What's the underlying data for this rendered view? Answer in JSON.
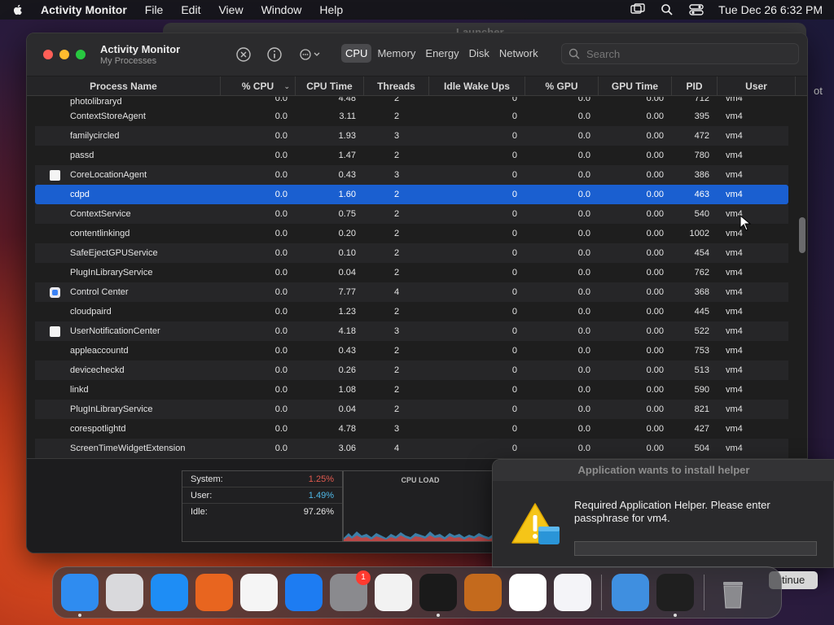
{
  "menubar": {
    "app_name": "Activity Monitor",
    "menus": [
      "File",
      "Edit",
      "View",
      "Window",
      "Help"
    ],
    "clock": "Tue Dec 26  6:32 PM"
  },
  "background": {
    "window_title": "Launcher",
    "side_text": "ot"
  },
  "window": {
    "title": "Activity Monitor",
    "subtitle": "My Processes",
    "tabs": [
      "CPU",
      "Memory",
      "Energy",
      "Disk",
      "Network"
    ],
    "active_tab": "CPU",
    "search_placeholder": "Search"
  },
  "table": {
    "columns": [
      "Process Name",
      "% CPU",
      "CPU Time",
      "Threads",
      "Idle Wake Ups",
      "% GPU",
      "GPU Time",
      "PID",
      "User"
    ],
    "partial_top": {
      "name": "photolibraryd",
      "cpu": "0.0",
      "cpu_time": "4.48",
      "threads": "2",
      "idle": "0",
      "gpu": "0.0",
      "gpu_time": "0.00",
      "pid": "712",
      "user": "vm4"
    },
    "rows": [
      {
        "name": "ContextStoreAgent",
        "icon": "none",
        "cpu": "0.0",
        "cpu_time": "3.11",
        "threads": "2",
        "idle": "0",
        "gpu": "0.0",
        "gpu_time": "0.00",
        "pid": "395",
        "user": "vm4"
      },
      {
        "name": "familycircled",
        "icon": "none",
        "cpu": "0.0",
        "cpu_time": "1.93",
        "threads": "3",
        "idle": "0",
        "gpu": "0.0",
        "gpu_time": "0.00",
        "pid": "472",
        "user": "vm4"
      },
      {
        "name": "passd",
        "icon": "none",
        "cpu": "0.0",
        "cpu_time": "1.47",
        "threads": "2",
        "idle": "0",
        "gpu": "0.0",
        "gpu_time": "0.00",
        "pid": "780",
        "user": "vm4"
      },
      {
        "name": "CoreLocationAgent",
        "icon": "white",
        "cpu": "0.0",
        "cpu_time": "0.43",
        "threads": "3",
        "idle": "0",
        "gpu": "0.0",
        "gpu_time": "0.00",
        "pid": "386",
        "user": "vm4"
      },
      {
        "name": "cdpd",
        "icon": "none",
        "cpu": "0.0",
        "cpu_time": "1.60",
        "threads": "2",
        "idle": "0",
        "gpu": "0.0",
        "gpu_time": "0.00",
        "pid": "463",
        "user": "vm4",
        "selected": true
      },
      {
        "name": "ContextService",
        "icon": "none",
        "cpu": "0.0",
        "cpu_time": "0.75",
        "threads": "2",
        "idle": "0",
        "gpu": "0.0",
        "gpu_time": "0.00",
        "pid": "540",
        "user": "vm4"
      },
      {
        "name": "contentlinkingd",
        "icon": "none",
        "cpu": "0.0",
        "cpu_time": "0.20",
        "threads": "2",
        "idle": "0",
        "gpu": "0.0",
        "gpu_time": "0.00",
        "pid": "1002",
        "user": "vm4"
      },
      {
        "name": "SafeEjectGPUService",
        "icon": "none",
        "cpu": "0.0",
        "cpu_time": "0.10",
        "threads": "2",
        "idle": "0",
        "gpu": "0.0",
        "gpu_time": "0.00",
        "pid": "454",
        "user": "vm4"
      },
      {
        "name": "PlugInLibraryService",
        "icon": "none",
        "cpu": "0.0",
        "cpu_time": "0.04",
        "threads": "2",
        "idle": "0",
        "gpu": "0.0",
        "gpu_time": "0.00",
        "pid": "762",
        "user": "vm4"
      },
      {
        "name": "Control Center",
        "icon": "cc",
        "cpu": "0.0",
        "cpu_time": "7.77",
        "threads": "4",
        "idle": "0",
        "gpu": "0.0",
        "gpu_time": "0.00",
        "pid": "368",
        "user": "vm4"
      },
      {
        "name": "cloudpaird",
        "icon": "none",
        "cpu": "0.0",
        "cpu_time": "1.23",
        "threads": "2",
        "idle": "0",
        "gpu": "0.0",
        "gpu_time": "0.00",
        "pid": "445",
        "user": "vm4"
      },
      {
        "name": "UserNotificationCenter",
        "icon": "white",
        "cpu": "0.0",
        "cpu_time": "4.18",
        "threads": "3",
        "idle": "0",
        "gpu": "0.0",
        "gpu_time": "0.00",
        "pid": "522",
        "user": "vm4"
      },
      {
        "name": "appleaccountd",
        "icon": "none",
        "cpu": "0.0",
        "cpu_time": "0.43",
        "threads": "2",
        "idle": "0",
        "gpu": "0.0",
        "gpu_time": "0.00",
        "pid": "753",
        "user": "vm4"
      },
      {
        "name": "devicecheckd",
        "icon": "none",
        "cpu": "0.0",
        "cpu_time": "0.26",
        "threads": "2",
        "idle": "0",
        "gpu": "0.0",
        "gpu_time": "0.00",
        "pid": "513",
        "user": "vm4"
      },
      {
        "name": "linkd",
        "icon": "none",
        "cpu": "0.0",
        "cpu_time": "1.08",
        "threads": "2",
        "idle": "0",
        "gpu": "0.0",
        "gpu_time": "0.00",
        "pid": "590",
        "user": "vm4"
      },
      {
        "name": "PlugInLibraryService",
        "icon": "none",
        "cpu": "0.0",
        "cpu_time": "0.04",
        "threads": "2",
        "idle": "0",
        "gpu": "0.0",
        "gpu_time": "0.00",
        "pid": "821",
        "user": "vm4"
      },
      {
        "name": "corespotlightd",
        "icon": "none",
        "cpu": "0.0",
        "cpu_time": "4.78",
        "threads": "3",
        "idle": "0",
        "gpu": "0.0",
        "gpu_time": "0.00",
        "pid": "427",
        "user": "vm4"
      },
      {
        "name": "ScreenTimeWidgetExtension",
        "icon": "none",
        "cpu": "0.0",
        "cpu_time": "3.06",
        "threads": "4",
        "idle": "0",
        "gpu": "0.0",
        "gpu_time": "0.00",
        "pid": "504",
        "user": "vm4"
      }
    ]
  },
  "stats": {
    "system_label": "System:",
    "system_value": "1.25%",
    "system_color": "#e25a4f",
    "user_label": "User:",
    "user_value": "1.49%",
    "user_color": "#4fb8e8",
    "idle_label": "Idle:",
    "idle_value": "97.26%"
  },
  "cpu_load": {
    "label": "CPU LOAD"
  },
  "dialog": {
    "title": "Application wants to install helper",
    "message": "Required Application Helper. Please enter passphrase for vm4.",
    "continue_label": "tinue"
  },
  "dock": {
    "items": [
      {
        "name": "finder",
        "color": "#2f8cf0"
      },
      {
        "name": "launchpad",
        "color": "#d9d9dc"
      },
      {
        "name": "safari",
        "color": "#1e8df5"
      },
      {
        "name": "firefox",
        "color": "#e8651f"
      },
      {
        "name": "chrome",
        "color": "#f5f5f5"
      },
      {
        "name": "app-store",
        "color": "#1d7cf2"
      },
      {
        "name": "system-settings",
        "color": "#8a8a8e",
        "badge": "1"
      },
      {
        "name": "textedit",
        "color": "#f2f2f2"
      },
      {
        "name": "terminal",
        "color": "#1a1a1a"
      },
      {
        "name": "garageband",
        "color": "#c46a1d"
      },
      {
        "name": "vscode",
        "color": "#ffffff"
      },
      {
        "name": "visual-studio",
        "color": "#f4f4f8"
      },
      {
        "name": "weather",
        "color": "#3f8fe0"
      },
      {
        "name": "activity-monitor",
        "color": "#1f1f1f"
      },
      {
        "name": "trash",
        "color": "transparent"
      }
    ]
  }
}
